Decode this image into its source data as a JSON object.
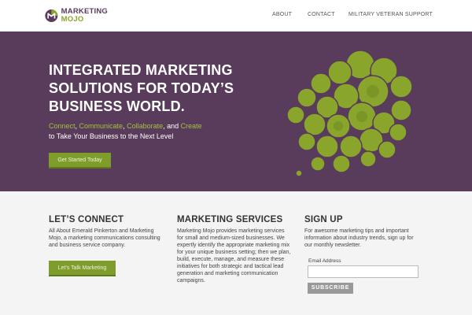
{
  "brand": {
    "logo_line1": "MARKETING",
    "logo_line2": "MOJO",
    "colors": {
      "purple": "#593b5b",
      "green": "#8aa52b",
      "accent_text": "#a4c23a"
    }
  },
  "nav": {
    "items": [
      {
        "label": "ABOUT"
      },
      {
        "label": "CONTACT"
      },
      {
        "label": "MILITARY VETERAN SUPPORT"
      }
    ]
  },
  "hero": {
    "title_lines": [
      "INTEGRATED MARKETING",
      "SOLUTIONS FOR TODAY’S",
      "BUSINESS WORLD."
    ],
    "tagline": {
      "connect": "Connect",
      "sep1": ", ",
      "communicate": "Communicate",
      "sep2": ", ",
      "collaborate": "Collaborate",
      "sep3": ", and ",
      "create": "Create",
      "line2": "to Take Your Business to the Next Level"
    },
    "cta_label": "Get Started Today",
    "graphic_icon": "speech-bubbles-cluster-icon"
  },
  "columns": {
    "connect": {
      "title": "LET’S CONNECT",
      "text_lines": [
        "All About Emerald Pinkerton and Marketing",
        "Mojo, a marketing communications consulting",
        "and business service company."
      ],
      "button_label": "Let’s Talk Marketing"
    },
    "services": {
      "title": "MARKETING SERVICES",
      "text_lines": [
        "Marketing Mojo provides marketing services",
        "for small and medium-sized businesses. We",
        "expertly identify the appropriate marketing mix",
        "for your unique business setting; then we plan,",
        "build, execute, manage, and measure these",
        "initiatives for both strategic and tactical lead",
        "generation and marketing communication",
        "campaigns."
      ]
    },
    "signup": {
      "title": "SIGN UP",
      "text_lines": [
        "For awesome marketing tips and important",
        "information about industry trends, sign up for",
        "our monthly newsletter."
      ],
      "email_label": "Email Address",
      "email_value": "",
      "subscribe_label": "SUBSCRIBE"
    }
  }
}
